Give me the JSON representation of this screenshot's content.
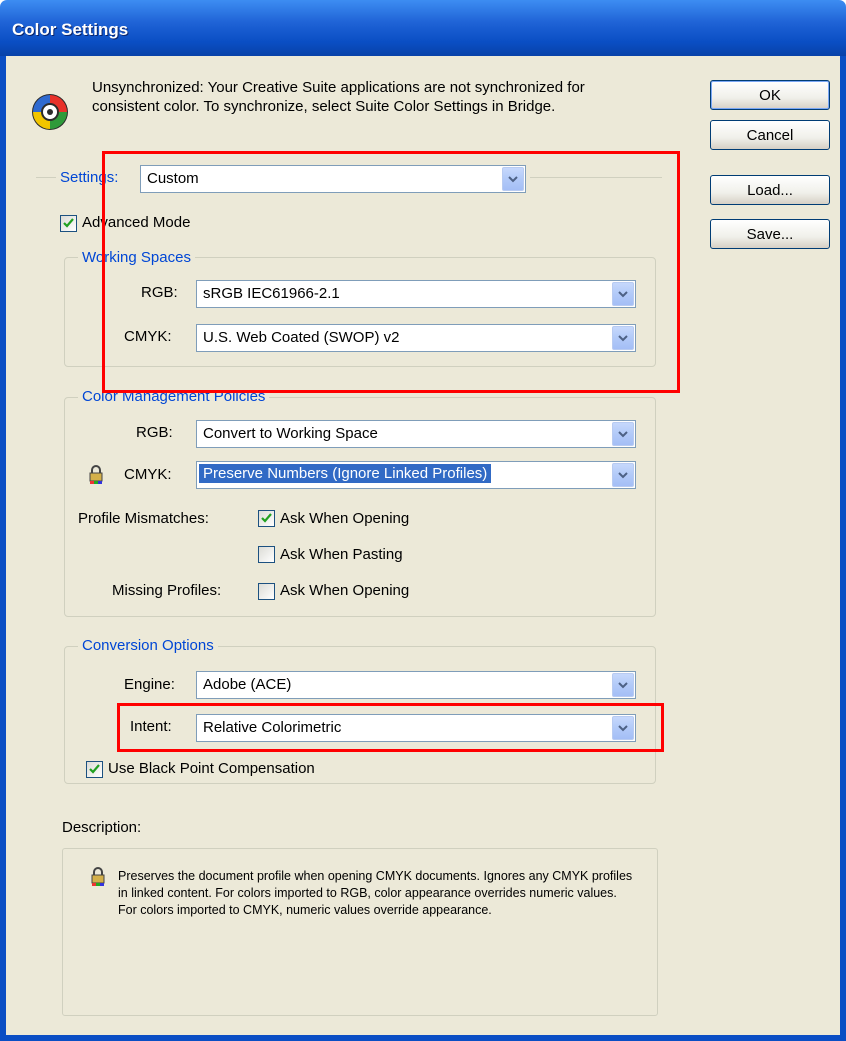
{
  "window": {
    "title": "Color Settings"
  },
  "sync_message": "Unsynchronized: Your Creative Suite applications are not synchronized for consistent color. To synchronize, select Suite Color Settings in Bridge.",
  "buttons": {
    "ok": "OK",
    "cancel": "Cancel",
    "load": "Load...",
    "save": "Save..."
  },
  "settings": {
    "label": "Settings:",
    "value": "Custom"
  },
  "advanced_mode": {
    "label": "Advanced Mode",
    "checked": true
  },
  "working_spaces": {
    "title": "Working Spaces",
    "rgb_label": "RGB:",
    "rgb_value": "sRGB IEC61966-2.1",
    "cmyk_label": "CMYK:",
    "cmyk_value": "U.S. Web Coated (SWOP) v2"
  },
  "policies": {
    "title": "Color Management Policies",
    "rgb_label": "RGB:",
    "rgb_value": "Convert to Working Space",
    "cmyk_label": "CMYK:",
    "cmyk_value": "Preserve Numbers (Ignore Linked Profiles)",
    "profile_mismatches_label": "Profile Mismatches:",
    "ask_opening_label": "Ask When Opening",
    "ask_opening_checked": true,
    "ask_pasting_label": "Ask When Pasting",
    "ask_pasting_checked": false,
    "missing_profiles_label": "Missing Profiles:",
    "missing_ask_opening_label": "Ask When Opening",
    "missing_ask_opening_checked": false
  },
  "conversion": {
    "title": "Conversion Options",
    "engine_label": "Engine:",
    "engine_value": "Adobe (ACE)",
    "intent_label": "Intent:",
    "intent_value": "Relative Colorimetric",
    "bpc_label": "Use Black Point Compensation",
    "bpc_checked": true
  },
  "description": {
    "label": "Description:",
    "text": "Preserves the document profile when opening CMYK documents. Ignores any CMYK profiles in linked content. For colors imported to RGB, color appearance overrides numeric values. For colors imported to CMYK, numeric values override appearance."
  },
  "colors": {
    "highlight": "#ff0000",
    "title_bar": "#0a4ec4",
    "group_title": "#0046d5",
    "selection": "#316ac5"
  }
}
